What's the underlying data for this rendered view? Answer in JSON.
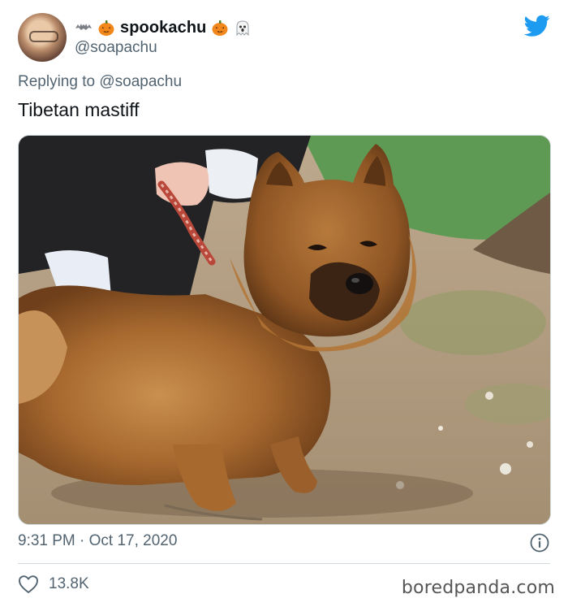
{
  "user": {
    "display_name": "spookachu",
    "handle": "@soapachu",
    "name_prefix_emoji": [
      "bat-emoji",
      "jack-o-lantern-emoji"
    ],
    "name_suffix_emoji": [
      "jack-o-lantern-emoji",
      "ghost-emoji"
    ]
  },
  "reply": {
    "prefix": "Replying to ",
    "mention": "@soapachu"
  },
  "tweet": {
    "text": "Tibetan mastiff",
    "timestamp": "9:31 PM · Oct 17, 2020",
    "like_count": "13.8K"
  },
  "icons": {
    "brand": "twitter-bird-icon",
    "info": "info-icon",
    "like": "heart-icon"
  },
  "watermark": "boredpanda.com",
  "colors": {
    "twitter_blue": "#1d9bf0",
    "secondary_text": "#536471",
    "divider": "#cfd9de"
  }
}
